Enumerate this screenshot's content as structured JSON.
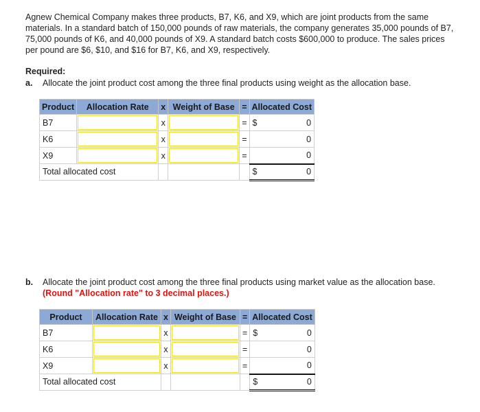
{
  "intro": "Agnew Chemical Company makes three products, B7, K6, and X9, which are joint products from the same materials. In a standard batch of 150,000 pounds of raw materials, the company generates 35,000 pounds of B7, 75,000 pounds of K6, and 40,000 pounds of X9. A standard batch costs $600,000 to produce. The sales prices per pound are $6, $10, and $16 for B7, K6, and X9, respectively.",
  "required_label": "Required:",
  "part_a": {
    "letter": "a.",
    "text": "Allocate the joint product cost among the three final products using weight as the allocation base."
  },
  "part_b": {
    "letter": "b.",
    "text": "Allocate the joint product cost among the three final products using market value as the allocation base.",
    "hint": "(Round \"Allocation rate\" to 3 decimal places.)"
  },
  "table": {
    "headers": [
      "Product",
      "Allocation Rate",
      "x",
      "Weight of Base",
      "=",
      "Allocated Cost"
    ],
    "rows": [
      {
        "product": "B7",
        "op1": "x",
        "op2": "=",
        "currency": "$",
        "cost": "0"
      },
      {
        "product": "K6",
        "op1": "x",
        "op2": "=",
        "currency": "",
        "cost": "0"
      },
      {
        "product": "X9",
        "op1": "x",
        "op2": "=",
        "currency": "",
        "cost": "0"
      }
    ],
    "total_label": "Total allocated cost",
    "total_currency": "$",
    "total_cost": "0"
  }
}
